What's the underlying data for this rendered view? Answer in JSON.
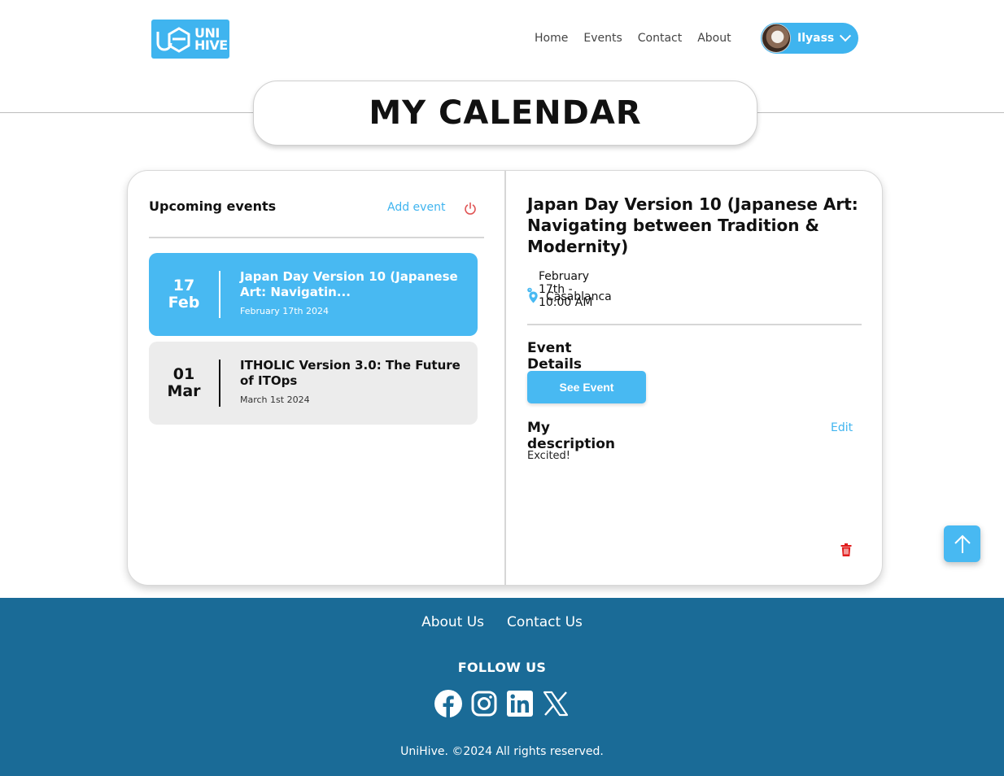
{
  "brand": {
    "logo_text_line1": "UNI",
    "logo_text_line2": "HIVE",
    "accent": "#3fb4ef",
    "footer_bg": "#1a6b97"
  },
  "nav": {
    "items": [
      "Home",
      "Events",
      "Contact",
      "About"
    ]
  },
  "user": {
    "name": "Ilyass"
  },
  "page_title": "MY CALENDAR",
  "left": {
    "heading": "Upcoming events",
    "add_event_label": "Add event",
    "events": [
      {
        "day": "17",
        "month": "Feb",
        "title": "Japan Day Version 10 (Japanese Art: Navigatin...",
        "date": "February 17th 2024"
      },
      {
        "day": "01",
        "month": "Mar",
        "title": "ITHOLIC Version 3.0: The Future of ITOps",
        "date": "March 1st 2024"
      }
    ]
  },
  "detail": {
    "title": "Japan Day Version 10 (Japanese Art: Navigating between Tradition & Modernity)",
    "datetime": "February 17th - 10:00 AM",
    "location": "Casablanca",
    "event_details_heading": "Event Details",
    "see_event_label": "See Event",
    "description_heading": "My description",
    "edit_label": "Edit",
    "description": "Excited!"
  },
  "footer": {
    "links": [
      "About Us",
      "Contact Us"
    ],
    "follow_label": "FOLLOW US",
    "socials": [
      "facebook-icon",
      "instagram-icon",
      "linkedin-icon",
      "x-icon"
    ],
    "copyright": "UniHive. ©2024 All rights reserved."
  }
}
